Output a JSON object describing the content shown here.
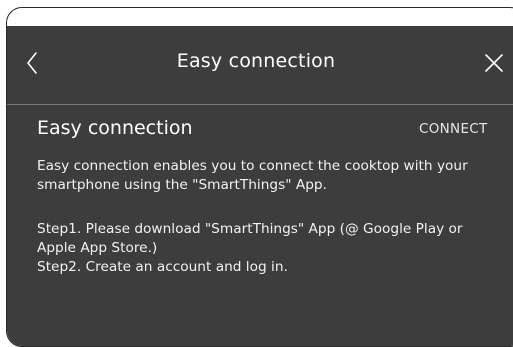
{
  "header": {
    "title": "Easy connection",
    "back_icon": "chevron-left-icon",
    "close_icon": "close-icon"
  },
  "section": {
    "title": "Easy connection",
    "connect_label": "CONNECT"
  },
  "description": {
    "line1": "Easy connection enables you to connect the cooktop with your",
    "line2": "smartphone using the \"SmartThings\" App."
  },
  "steps": {
    "step1_line1": "Step1. Please download \"SmartThings\" App (@ Google Play or",
    "step1_line2": "Apple App Store.)",
    "step2": "Step2. Create an account and log in."
  },
  "colors": {
    "screen_bg": "#3d3d3d",
    "text": "#ffffff",
    "divider": "#7a7a7a"
  }
}
